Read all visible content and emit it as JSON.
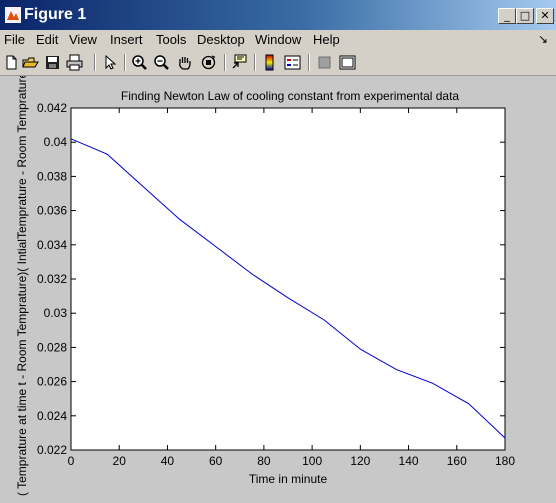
{
  "window": {
    "title": "Figure 1",
    "buttons": {
      "minimize": "_",
      "maximize": "□",
      "close": "✕"
    }
  },
  "menu": {
    "items": [
      "File",
      "Edit",
      "View",
      "Insert",
      "Tools",
      "Desktop",
      "Window",
      "Help"
    ]
  },
  "toolbar": {
    "icons": [
      "new-figure-icon",
      "open-file-icon",
      "save-icon",
      "print-icon",
      "edit-plot-arrow-icon",
      "zoom-in-icon",
      "zoom-out-icon",
      "pan-hand-icon",
      "rotate-3d-icon",
      "data-cursor-icon",
      "colorbar-icon",
      "legend-icon",
      "hide-plot-tools-icon",
      "show-plot-tools-icon"
    ]
  },
  "colors": {
    "line": "#0000cc",
    "figure_bg": "#c8c8c8",
    "axes_bg": "#ffffff"
  },
  "chart_data": {
    "type": "line",
    "title": "Finding Newton Law of cooling constant from experimental data",
    "xlabel": "Time in minute",
    "ylabel": "( Temprature at time t  - Room Temprature)( IntialTemprature  - Room Temprature)",
    "xlim": [
      0,
      180
    ],
    "ylim": [
      0.022,
      0.042
    ],
    "xticks": [
      "0",
      "20",
      "40",
      "60",
      "80",
      "100",
      "120",
      "140",
      "160",
      "180"
    ],
    "yticks": [
      "0.022",
      "0.024",
      "0.026",
      "0.028",
      "0.03",
      "0.032",
      "0.034",
      "0.036",
      "0.038",
      "0.04",
      "0.042"
    ],
    "grid": false,
    "series": [
      {
        "x": [
          0,
          15,
          30,
          45,
          60,
          75,
          90,
          105,
          120,
          135,
          150,
          165,
          180
        ],
        "y": [
          0.0402,
          0.0393,
          0.0374,
          0.0355,
          0.0339,
          0.0323,
          0.0309,
          0.0296,
          0.0279,
          0.0267,
          0.0259,
          0.0247,
          0.0227
        ]
      }
    ]
  }
}
